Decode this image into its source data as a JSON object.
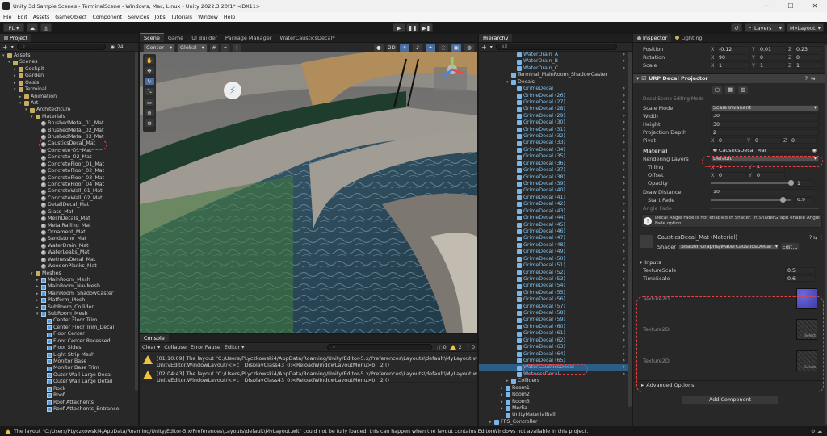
{
  "window": {
    "title": "Unity 3d Sample Scenes - TerminalScene - Windows, Mac, Linux - Unity 2022.3.20f1* <DX11>"
  },
  "menu": [
    "File",
    "Edit",
    "Assets",
    "GameObject",
    "Component",
    "Services",
    "Jobs",
    "Tutorials",
    "Window",
    "Help"
  ],
  "toolbar": {
    "account": "PL ▾",
    "layers": "Layers",
    "layout": "MyLayout"
  },
  "project": {
    "tab": "Project",
    "count": "24",
    "rows": [
      {
        "d": 0,
        "t": "Assets",
        "i": "folder",
        "a": "▾"
      },
      {
        "d": 1,
        "t": "Scenes",
        "i": "folder",
        "a": "▾"
      },
      {
        "d": 2,
        "t": "Cockpit",
        "i": "folder",
        "a": "▸"
      },
      {
        "d": 2,
        "t": "Garden",
        "i": "folder",
        "a": "▸"
      },
      {
        "d": 2,
        "t": "Oasis",
        "i": "folder",
        "a": "▸"
      },
      {
        "d": 2,
        "t": "Terminal",
        "i": "folder",
        "a": "▾"
      },
      {
        "d": 3,
        "t": "Animation",
        "i": "folder",
        "a": "▸"
      },
      {
        "d": 3,
        "t": "Art",
        "i": "folder",
        "a": "▾"
      },
      {
        "d": 4,
        "t": "Architechture",
        "i": "folder",
        "a": "▾"
      },
      {
        "d": 5,
        "t": "Materials",
        "i": "folder",
        "a": "▾"
      },
      {
        "d": 6,
        "t": "BrushedMetal_01_Mat",
        "i": "sphere",
        "a": ""
      },
      {
        "d": 6,
        "t": "BrushedMetal_02_Mat",
        "i": "sphere",
        "a": ""
      },
      {
        "d": 6,
        "t": "BrushedMetal_03_Mat",
        "i": "sphere",
        "a": ""
      },
      {
        "d": 6,
        "t": "CausticsDecal_Mat",
        "i": "sphere",
        "a": ""
      },
      {
        "d": 6,
        "t": "Concrete_01_Mat",
        "i": "sphere",
        "a": ""
      },
      {
        "d": 6,
        "t": "Concrete_02_Mat",
        "i": "sphere",
        "a": ""
      },
      {
        "d": 6,
        "t": "ConcreteFloor_01_Mat",
        "i": "sphere",
        "a": ""
      },
      {
        "d": 6,
        "t": "ConcreteFloor_02_Mat",
        "i": "sphere",
        "a": ""
      },
      {
        "d": 6,
        "t": "ConcreteFloor_03_Mat",
        "i": "sphere",
        "a": ""
      },
      {
        "d": 6,
        "t": "ConcreteFloor_04_Mat",
        "i": "sphere",
        "a": ""
      },
      {
        "d": 6,
        "t": "ConcreteWall_01_Mat",
        "i": "sphere",
        "a": ""
      },
      {
        "d": 6,
        "t": "ConcreteWall_02_Mat",
        "i": "sphere",
        "a": ""
      },
      {
        "d": 6,
        "t": "DetailDecal_Mat",
        "i": "sphere",
        "a": ""
      },
      {
        "d": 6,
        "t": "Glass_Mat",
        "i": "sphere",
        "a": ""
      },
      {
        "d": 6,
        "t": "MeshDecals_Mat",
        "i": "sphere",
        "a": ""
      },
      {
        "d": 6,
        "t": "MetalRailing_Mat",
        "i": "sphere",
        "a": ""
      },
      {
        "d": 6,
        "t": "Ornament_Mat",
        "i": "sphere",
        "a": ""
      },
      {
        "d": 6,
        "t": "Sandstone_Mat",
        "i": "sphere",
        "a": ""
      },
      {
        "d": 6,
        "t": "WaterDrain_Mat",
        "i": "sphere",
        "a": ""
      },
      {
        "d": 6,
        "t": "WaterLeaks_Mat",
        "i": "sphere",
        "a": ""
      },
      {
        "d": 6,
        "t": "WetnessDecal_Mat",
        "i": "sphere",
        "a": ""
      },
      {
        "d": 6,
        "t": "WoodenPlanks_Mat",
        "i": "sphere",
        "a": ""
      },
      {
        "d": 5,
        "t": "Meshes",
        "i": "folder",
        "a": "▾"
      },
      {
        "d": 6,
        "t": "MainRoom_Mesh",
        "i": "mesh",
        "a": "▸"
      },
      {
        "d": 6,
        "t": "MainRoom_NavMesh",
        "i": "mesh",
        "a": "▸"
      },
      {
        "d": 6,
        "t": "MainRoom_ShadowCaster",
        "i": "mesh",
        "a": "▸"
      },
      {
        "d": 6,
        "t": "Platform_Mesh",
        "i": "mesh",
        "a": "▸"
      },
      {
        "d": 6,
        "t": "SubRoom_Collider",
        "i": "mesh",
        "a": "▸"
      },
      {
        "d": 6,
        "t": "SubRoom_Mesh",
        "i": "mesh",
        "a": "▾"
      },
      {
        "d": 7,
        "t": "Center Floor Trim",
        "i": "mesh",
        "a": ""
      },
      {
        "d": 7,
        "t": "Center Floor Trim_Decal",
        "i": "mesh",
        "a": ""
      },
      {
        "d": 7,
        "t": "Floor Center",
        "i": "mesh",
        "a": ""
      },
      {
        "d": 7,
        "t": "Floor Center Recessed",
        "i": "mesh",
        "a": ""
      },
      {
        "d": 7,
        "t": "Floor Sides",
        "i": "mesh",
        "a": ""
      },
      {
        "d": 7,
        "t": "Light Strip Mesh",
        "i": "mesh",
        "a": ""
      },
      {
        "d": 7,
        "t": "Monitor Base",
        "i": "mesh",
        "a": ""
      },
      {
        "d": 7,
        "t": "Monitor Base Trim",
        "i": "mesh",
        "a": ""
      },
      {
        "d": 7,
        "t": "Outer Wall Large Decal",
        "i": "mesh",
        "a": ""
      },
      {
        "d": 7,
        "t": "Outer Wall Large Detail",
        "i": "mesh",
        "a": ""
      },
      {
        "d": 7,
        "t": "Rock",
        "i": "mesh",
        "a": ""
      },
      {
        "d": 7,
        "t": "Roof",
        "i": "mesh",
        "a": ""
      },
      {
        "d": 7,
        "t": "Roof Attachents",
        "i": "mesh",
        "a": ""
      },
      {
        "d": 7,
        "t": "Roof Attachents_Entrance",
        "i": "mesh",
        "a": ""
      }
    ]
  },
  "scene": {
    "tabs": [
      "Scene",
      "Game",
      "UI Builder",
      "Package Manager",
      "WaterCausticsDecal*"
    ],
    "pivot": "Center",
    "space": "Global",
    "mode2d": "2D"
  },
  "console": {
    "tab": "Console",
    "clear": "Clear",
    "collapse": "Collapse",
    "errorpause": "Error Pause",
    "editor": "Editor",
    "count_info": "0",
    "count_warn": "2",
    "count_err": "0",
    "msgs": [
      {
        "l1": "[01:10:09] The layout \"C:/Users/PLyczkowski4/AppData/Roaming/Unity/Editor-5.x/Preferences\\Layouts\\default\\MyLayout.wlt\" could n",
        "l2": "UnityEditor.WindowLayout/<>c__DisplayClass43_0:<ReloadWindowLayoutMenu>b__2 ()"
      },
      {
        "l1": "[02:04:43] The layout \"C:/Users/PLyczkowski4/AppData/Roaming/Unity/Editor-5.x/Preferences\\Layouts\\default\\MyLayout.wlt\" could n",
        "l2": "UnityEditor.WindowLayout/<>c__DisplayClass43_0:<ReloadWindowLayoutMenu>b__2 ()"
      }
    ]
  },
  "hierarchy": {
    "tab": "Hierarchy",
    "search": "All",
    "rows": [
      {
        "d": 5,
        "t": "WaterDrain_A",
        "a": ""
      },
      {
        "d": 5,
        "t": "WaterDrain_B",
        "a": ""
      },
      {
        "d": 5,
        "t": "WaterDrain_C",
        "a": ""
      },
      {
        "d": 4,
        "t": "Terminal_MainRoom_ShadowCaster",
        "a": ""
      },
      {
        "d": 4,
        "t": "Decals",
        "a": "▾"
      },
      {
        "d": 5,
        "t": "GrimeDecal",
        "a": ""
      },
      {
        "d": 5,
        "t": "GrimeDecal (26)",
        "a": ""
      },
      {
        "d": 5,
        "t": "GrimeDecal (27)",
        "a": ""
      },
      {
        "d": 5,
        "t": "GrimeDecal (28)",
        "a": ""
      },
      {
        "d": 5,
        "t": "GrimeDecal (29)",
        "a": ""
      },
      {
        "d": 5,
        "t": "GrimeDecal (30)",
        "a": ""
      },
      {
        "d": 5,
        "t": "GrimeDecal (31)",
        "a": ""
      },
      {
        "d": 5,
        "t": "GrimeDecal (32)",
        "a": ""
      },
      {
        "d": 5,
        "t": "GrimeDecal (33)",
        "a": ""
      },
      {
        "d": 5,
        "t": "GrimeDecal (34)",
        "a": ""
      },
      {
        "d": 5,
        "t": "GrimeDecal (35)",
        "a": ""
      },
      {
        "d": 5,
        "t": "GrimeDecal (36)",
        "a": ""
      },
      {
        "d": 5,
        "t": "GrimeDecal (37)",
        "a": ""
      },
      {
        "d": 5,
        "t": "GrimeDecal (38)",
        "a": ""
      },
      {
        "d": 5,
        "t": "GrimeDecal (39)",
        "a": ""
      },
      {
        "d": 5,
        "t": "GrimeDecal (40)",
        "a": ""
      },
      {
        "d": 5,
        "t": "GrimeDecal (41)",
        "a": ""
      },
      {
        "d": 5,
        "t": "GrimeDecal (42)",
        "a": ""
      },
      {
        "d": 5,
        "t": "GrimeDecal (43)",
        "a": ""
      },
      {
        "d": 5,
        "t": "GrimeDecal (44)",
        "a": ""
      },
      {
        "d": 5,
        "t": "GrimeDecal (45)",
        "a": ""
      },
      {
        "d": 5,
        "t": "GrimeDecal (46)",
        "a": ""
      },
      {
        "d": 5,
        "t": "GrimeDecal (47)",
        "a": ""
      },
      {
        "d": 5,
        "t": "GrimeDecal (48)",
        "a": ""
      },
      {
        "d": 5,
        "t": "GrimeDecal (49)",
        "a": ""
      },
      {
        "d": 5,
        "t": "GrimeDecal (50)",
        "a": ""
      },
      {
        "d": 5,
        "t": "GrimeDecal (51)",
        "a": ""
      },
      {
        "d": 5,
        "t": "GrimeDecal (52)",
        "a": ""
      },
      {
        "d": 5,
        "t": "GrimeDecal (53)",
        "a": ""
      },
      {
        "d": 5,
        "t": "GrimeDecal (54)",
        "a": ""
      },
      {
        "d": 5,
        "t": "GrimeDecal (55)",
        "a": ""
      },
      {
        "d": 5,
        "t": "GrimeDecal (56)",
        "a": ""
      },
      {
        "d": 5,
        "t": "GrimeDecal (57)",
        "a": ""
      },
      {
        "d": 5,
        "t": "GrimeDecal (58)",
        "a": ""
      },
      {
        "d": 5,
        "t": "GrimeDecal (59)",
        "a": ""
      },
      {
        "d": 5,
        "t": "GrimeDecal (60)",
        "a": ""
      },
      {
        "d": 5,
        "t": "GrimeDecal (61)",
        "a": ""
      },
      {
        "d": 5,
        "t": "GrimeDecal (62)",
        "a": ""
      },
      {
        "d": 5,
        "t": "GrimeDecal (63)",
        "a": ""
      },
      {
        "d": 5,
        "t": "GrimeDecal (64)",
        "a": ""
      },
      {
        "d": 5,
        "t": "GrimeDecal (65)",
        "a": ""
      },
      {
        "d": 5,
        "t": "WaterCausticsDecal",
        "a": ""
      },
      {
        "d": 5,
        "t": "WetnessDecal",
        "a": ""
      },
      {
        "d": 4,
        "t": "Colliders",
        "a": "▸"
      },
      {
        "d": 3,
        "t": "Room1",
        "a": "▸"
      },
      {
        "d": 3,
        "t": "Room2",
        "a": "▸"
      },
      {
        "d": 3,
        "t": "Room3",
        "a": "▸"
      },
      {
        "d": 3,
        "t": "Media",
        "a": "▸"
      },
      {
        "d": 3,
        "t": "UnityMaterialBall",
        "a": ""
      },
      {
        "d": 1,
        "t": "FPS_Controller",
        "a": "▸"
      }
    ]
  },
  "inspector": {
    "tab": "Inspector",
    "tab2": "Lighting",
    "position": {
      "label": "Position",
      "x": "-0.12",
      "y": "0.01",
      "z": "0.23"
    },
    "rotation": {
      "label": "Rotation",
      "x": "90",
      "y": "0",
      "z": "0"
    },
    "scale": {
      "label": "Scale",
      "x": "1",
      "y": "1",
      "z": "1"
    },
    "component": "URP Decal Projector",
    "edit_mode": "Decal Scene Editing Mode",
    "scale_mode": {
      "label": "Scale Mode",
      "value": "Scale Invariant"
    },
    "width": {
      "label": "Width",
      "value": "30"
    },
    "height": {
      "label": "Height",
      "value": "30"
    },
    "depth": {
      "label": "Projection Depth",
      "value": "2"
    },
    "pivot": {
      "label": "Pivot",
      "x": "0",
      "y": "0",
      "z": "0"
    },
    "material": {
      "label": "Material",
      "value": "CausticsDecal_Mat"
    },
    "rendering_layers": {
      "label": "Rendering Layers",
      "value": "Default"
    },
    "tiling": {
      "label": "Tilling",
      "x": "1",
      "y": "1"
    },
    "offset": {
      "label": "Offset",
      "x": "0",
      "y": "0"
    },
    "opacity": {
      "label": "Opacity",
      "value": "1",
      "fraction": 1.0
    },
    "draw_distance": {
      "label": "Draw Distance",
      "value": "10"
    },
    "start_fade": {
      "label": "Start Fade",
      "value": "0.9",
      "fraction": 0.9
    },
    "angle_fade": {
      "label": "Angle Fade"
    },
    "info": "Decal Angle Fade is not enabled in Shader. In ShaderGraph enable Angle Fade option.",
    "mat_header": "CausticsDecal_Mat (Material)",
    "shader": {
      "label": "Shader",
      "value": "Shader Graphs/WaterCausticsDecal",
      "edit": "Edit..."
    },
    "inputs": "Inputs",
    "tex_scale": {
      "label": "TextureScale",
      "value": "0.5"
    },
    "time_scale": {
      "label": "TimeScale",
      "value": "0.6"
    },
    "tex": [
      "Texture2D",
      "Texture2D",
      "Texture2D"
    ],
    "select": "Select",
    "advanced": "Advanced Options",
    "add_component": "Add Component"
  },
  "status": {
    "text": "The layout \"C:/Users/PLyczkowski4/AppData/Roaming/Unity/Editor-5.x/Preferences\\Layouts\\default\\MyLayout.wlt\" could not be fully loaded, this can happen when the layout contains EditorWindows not available in this project."
  }
}
